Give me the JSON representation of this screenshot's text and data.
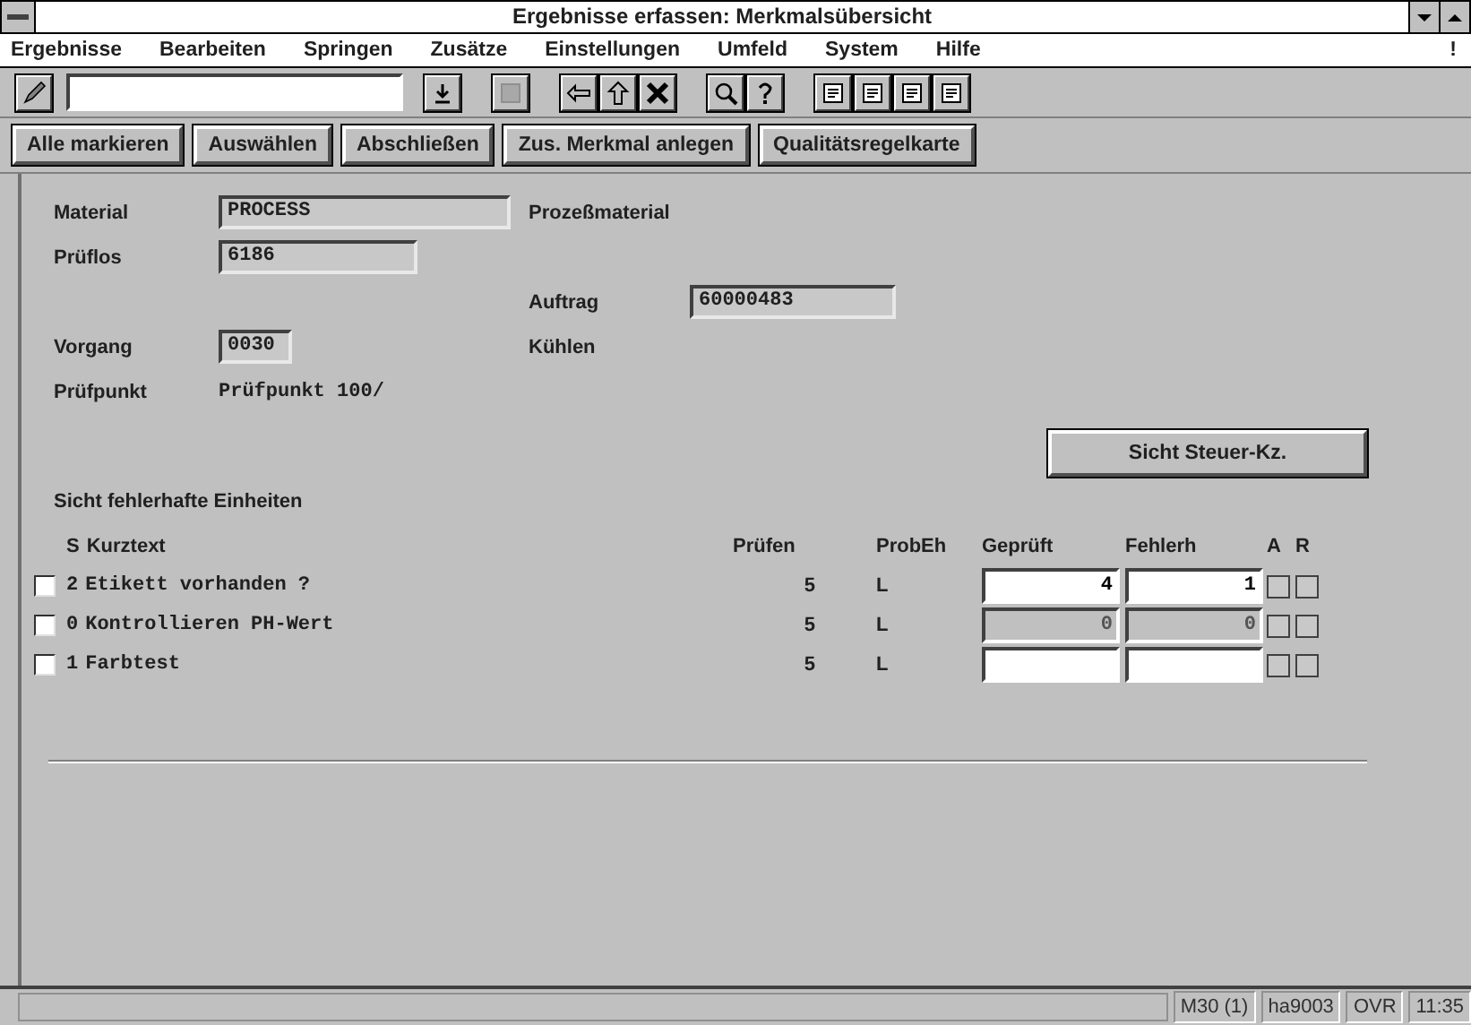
{
  "window": {
    "title": "Ergebnisse erfassen: Merkmalsübersicht"
  },
  "menu": [
    "Ergebnisse",
    "Bearbeiten",
    "Springen",
    "Zusätze",
    "Einstellungen",
    "Umfeld",
    "System",
    "Hilfe"
  ],
  "menu_end": "!",
  "buttons": [
    "Alle markieren",
    "Auswählen",
    "Abschließen",
    "Zus. Merkmal anlegen",
    "Qualitätsregelkarte"
  ],
  "header": {
    "material": {
      "label": "Material",
      "value": "PROCESS",
      "description": "Prozeßmaterial"
    },
    "prueflos": {
      "label": "Prüflos",
      "value": "6186"
    },
    "auftrag": {
      "label": "Auftrag",
      "value": "60000483"
    },
    "vorgang": {
      "label": "Vorgang",
      "value": "0030",
      "description": "Kühlen"
    },
    "pruefpunkt": {
      "label": "Prüfpunkt",
      "value": "Prüfpunkt 100/"
    }
  },
  "side_button": "Sicht Steuer-Kz.",
  "section_title": "Sicht fehlerhafte Einheiten",
  "table": {
    "columns": [
      "S",
      "Kurztext",
      "Prüfen",
      "ProbEh",
      "Geprüft",
      "Fehlerh",
      "A",
      "R"
    ],
    "rows": [
      {
        "checked": false,
        "s": "2",
        "kurztext": "Etikett vorhanden ?",
        "pruefen": "5",
        "probeh": "L",
        "geprueft": "4",
        "fehlerh": "1",
        "disabled": false,
        "a": false,
        "r": false
      },
      {
        "checked": false,
        "s": "0",
        "kurztext": "Kontrollieren PH-Wert",
        "pruefen": "5",
        "probeh": "L",
        "geprueft": "0",
        "fehlerh": "0",
        "disabled": true,
        "a": false,
        "r": false
      },
      {
        "checked": false,
        "s": "1",
        "kurztext": "Farbtest",
        "pruefen": "5",
        "probeh": "L",
        "disabled": false,
        "a": false,
        "r": false
      }
    ]
  },
  "status_bar": [
    "M30 (1)",
    "ha9003",
    "OVR",
    "11:35"
  ]
}
